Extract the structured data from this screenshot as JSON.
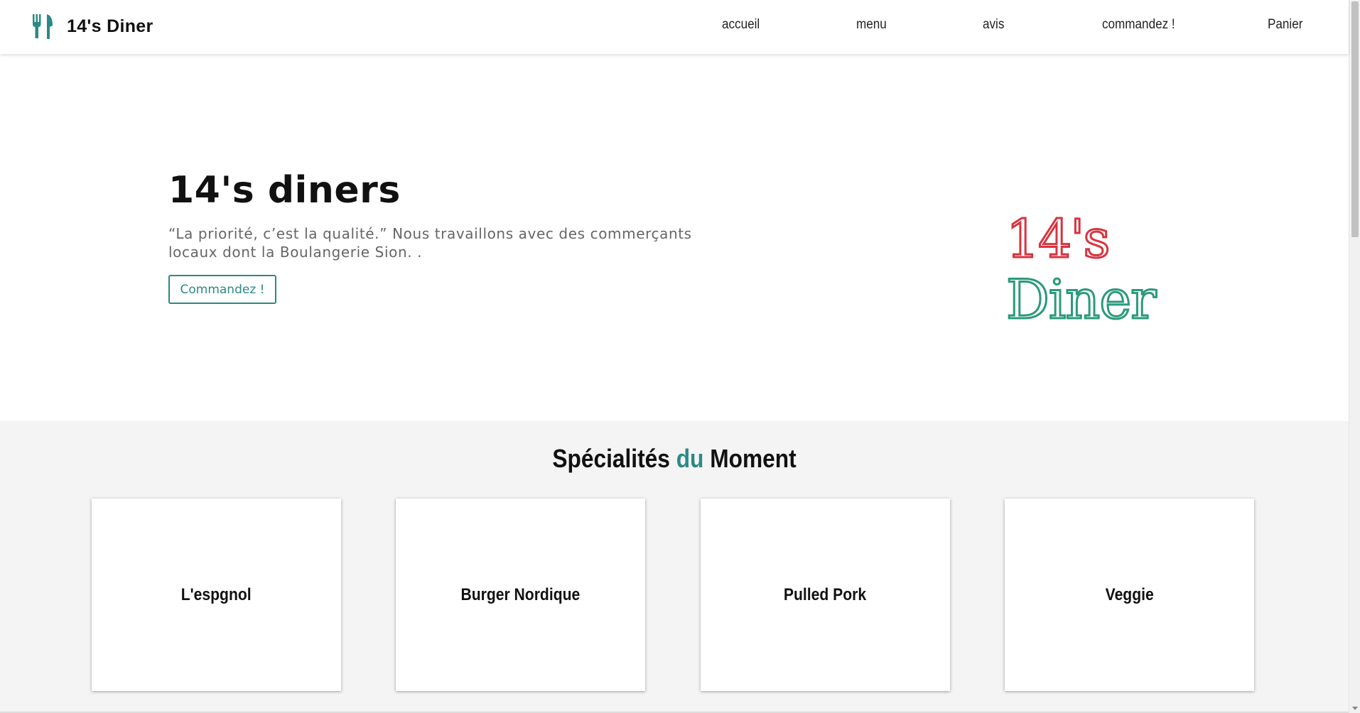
{
  "brand": {
    "name": "14's Diner",
    "icon": "utensils-icon",
    "color": "#2a8a84"
  },
  "nav": {
    "items": [
      {
        "label": "accueil"
      },
      {
        "label": "menu"
      },
      {
        "label": "avis"
      },
      {
        "label": "commandez !"
      },
      {
        "label": "Panier"
      }
    ]
  },
  "hero": {
    "title": "14's diners",
    "text": "“La priorité, c’est la qualité.” Nous travaillons avec des commerçants locaux dont la Boulangerie Sion. .",
    "button_label": "Commandez !",
    "logo": {
      "line1": "14's",
      "line2": "Diner",
      "color1": "#d8333f",
      "color2": "#2a9a7a"
    }
  },
  "specials": {
    "title_part1": "Spécialités",
    "title_accent": "du",
    "title_part2": "Moment",
    "accent_color": "#2a8a84",
    "cards": [
      {
        "name": "L'espgnol"
      },
      {
        "name": "Burger Nordique"
      },
      {
        "name": "Pulled Pork"
      },
      {
        "name": "Veggie"
      }
    ]
  }
}
